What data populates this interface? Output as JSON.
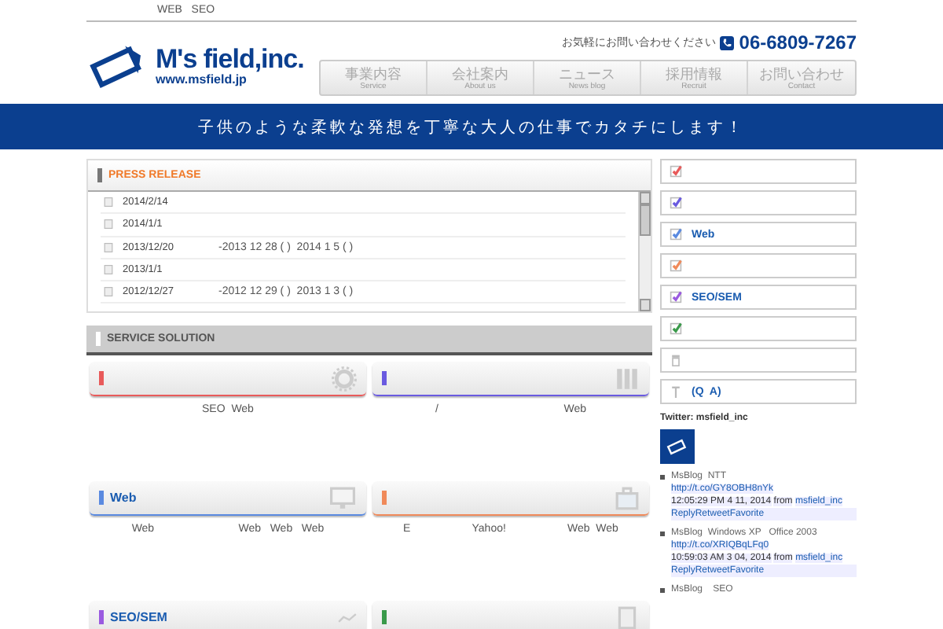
{
  "top_bar": {
    "text": "WEB   SEO"
  },
  "header": {
    "logo": {
      "name": "M's field,inc.",
      "url": "www.msfield.jp"
    },
    "contact_label": "お気軽にお問い合わせください",
    "phone": "06-6809-7267"
  },
  "nav": [
    {
      "label": "事業内容",
      "sub": "Service"
    },
    {
      "label": "会社案内",
      "sub": "About us"
    },
    {
      "label": "ニュース",
      "sub": "News blog"
    },
    {
      "label": "採用情報",
      "sub": "Recruit"
    },
    {
      "label": "お問い合わせ",
      "sub": "Contact"
    }
  ],
  "banner": {
    "text": "子供のような柔軟な発想を丁寧な大人の仕事でカタチにします！"
  },
  "press_release": {
    "title": "PRESS RELEASE",
    "items": [
      {
        "date": "2014/2/14"
      },
      {
        "date": "2014/1/1"
      },
      {
        "date": "2013/12/20",
        "text": "-2013 12 28 ( )  2014 1 5 ( )"
      },
      {
        "date": "2013/1/1"
      },
      {
        "date": "2012/12/27",
        "text": "-2012 12 29 ( )  2013 1 3 ( )"
      }
    ]
  },
  "service_solution": {
    "title": "SERVICE SOLUTION",
    "cards": [
      {
        "color": "#e85a5a",
        "kind": "gear",
        "body": [
          "SEO  Web"
        ]
      },
      {
        "color": "#6a5ae0",
        "kind": "books",
        "body": [
          "/",
          "Web"
        ]
      },
      {
        "color": "#5a8ae0",
        "kind": "monitor",
        "title": "Web",
        "body": [
          "Web",
          "Web   Web   Web"
        ]
      },
      {
        "color": "#f08a5a",
        "kind": "bag",
        "body": [
          "E",
          "Yahoo!",
          "Web  Web"
        ]
      },
      {
        "color": "#9a5ae0",
        "kind": "chart",
        "title": "SEO/SEM"
      },
      {
        "color": "#3a9a4a",
        "kind": "doc"
      }
    ]
  },
  "sidebar": {
    "items": [
      {
        "kind": "check",
        "color": "#e85a5a"
      },
      {
        "kind": "check",
        "color": "#6a5ae0"
      },
      {
        "kind": "check",
        "color": "#5a8ae0",
        "label": "Web"
      },
      {
        "kind": "check",
        "color": "#f08a5a"
      },
      {
        "kind": "check",
        "color": "#9a5ae0",
        "label": "SEO/SEM"
      },
      {
        "kind": "check",
        "color": "#3a9a4a"
      },
      {
        "kind": "bin"
      },
      {
        "kind": "pin",
        "label": "(Q  A)"
      }
    ]
  },
  "twitter": {
    "title": "Twitter: msfield_inc",
    "tweets": [
      {
        "text": "MsBlog  NTT",
        "link": "http://t.co/GY8OBH8nYk",
        "time": "12:05:29 PM 4 11, 2014",
        "from": "from",
        "user": "msfield_inc",
        "actions": "ReplyRetweetFavorite"
      },
      {
        "text": "MsBlog  Windows XP   Office 2003",
        "link": "http://t.co/XRIQBqLFq0",
        "time": "10:59:03 AM 3  04, 2014",
        "from": "from",
        "user": "msfield_inc",
        "actions": "ReplyRetweetFavorite"
      },
      {
        "text": "MsBlog    SEO"
      }
    ]
  }
}
